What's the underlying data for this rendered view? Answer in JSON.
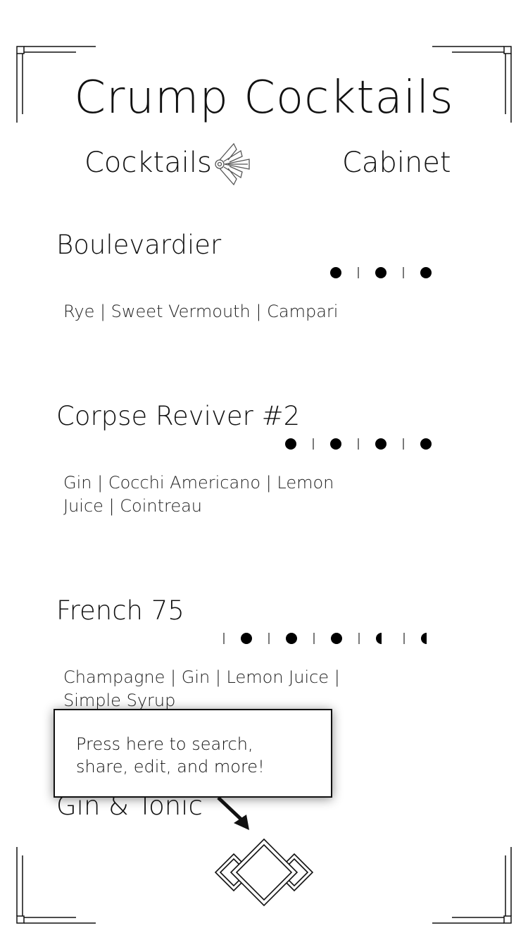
{
  "app": {
    "title": "Crump Cocktails"
  },
  "tabs": [
    {
      "label": "Cocktails"
    },
    {
      "label": "Cabinet"
    }
  ],
  "drinks": [
    {
      "name": "Boulevardier",
      "ingredients": "Rye | Sweet Vermouth | Campari",
      "strength": [
        1,
        1,
        1
      ]
    },
    {
      "name": "Corpse Reviver #2",
      "ingredients": "Gin | Cocchi Americano | Lemon Juice | Cointreau",
      "strength": [
        1,
        1,
        1,
        1
      ]
    },
    {
      "name": "French 75",
      "ingredients": "Champagne | Gin | Lemon Juice | Simple Syrup",
      "strength": [
        1,
        1,
        1,
        1,
        0.5,
        0.5
      ]
    },
    {
      "name": "Gin & Tonic"
    }
  ],
  "tooltip": {
    "text": "Press here to search, share, edit, and more!"
  },
  "icons": {
    "tab_separator": "art-deco-fan-icon",
    "menu_button": "art-deco-diamond-icon",
    "hint_arrow": "arrow-down-right-icon"
  },
  "colors": {
    "background": "#ffffff",
    "ink": "#111111"
  }
}
